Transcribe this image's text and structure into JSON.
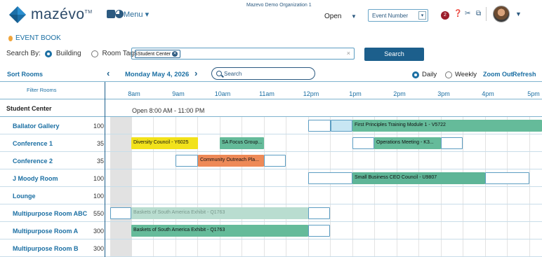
{
  "header": {
    "brand": "mazévo",
    "brand_mark": "TM",
    "menu_label": "Menu",
    "organization": "Mazevo Demo Organization 1",
    "open_label": "Open",
    "event_select": "Event Number",
    "notification_count": "2",
    "icons": [
      "calendar-plus-icon",
      "pie-chart-icon",
      "help-icon",
      "tools-icon",
      "copy-icon",
      "avatar",
      "chevron-down-icon"
    ]
  },
  "event_book": {
    "title": "EVENT BOOK",
    "search_by_label": "Search By:",
    "options": [
      "Building",
      "Room Tags"
    ],
    "selected_option": "Building",
    "tag": "Student Center",
    "search_button": "Search"
  },
  "toolbar": {
    "sort_rooms": "Sort Rooms",
    "date": "Monday May 4, 2026",
    "search_placeholder": "Search",
    "daily": "Daily",
    "weekly": "Weekly",
    "selected_view": "Daily",
    "zoom_out": "Zoom Out",
    "refresh": "Refresh"
  },
  "grid": {
    "filter_rooms": "Filter Rooms",
    "hours": [
      "8am",
      "9am",
      "10am",
      "11am",
      "12pm",
      "1pm",
      "2pm",
      "3pm",
      "4pm",
      "5pm"
    ],
    "building": "Student Center",
    "open_hours": "Open 8:00 AM - 11:00 PM",
    "rooms": [
      {
        "name": "Ballator Gallery",
        "capacity": "100"
      },
      {
        "name": "Conference 1",
        "capacity": "35"
      },
      {
        "name": "Conference 2",
        "capacity": "35"
      },
      {
        "name": "J Moody Room",
        "capacity": "100"
      },
      {
        "name": "Lounge",
        "capacity": "100"
      },
      {
        "name": "Multipurpose Room ABC",
        "capacity": "550"
      },
      {
        "name": "Multipurpose Room A",
        "capacity": "300"
      },
      {
        "name": "Multipurpose Room B",
        "capacity": "300"
      }
    ],
    "events": {
      "first_principles": "First Principles Training Module 1 - V5722",
      "diversity": "Diversity Council - Y6025",
      "sa_focus": "SA Focus Group...",
      "operations": "Operations Meeting - K3...",
      "community": "Community Outreach Pla...",
      "small_business": "Small Business CEO Council - U9807",
      "baskets_abc": "Baskets of South America Exhibit - Q1763",
      "baskets_a": "Baskets of South America Exhibit - Q1763"
    }
  }
}
